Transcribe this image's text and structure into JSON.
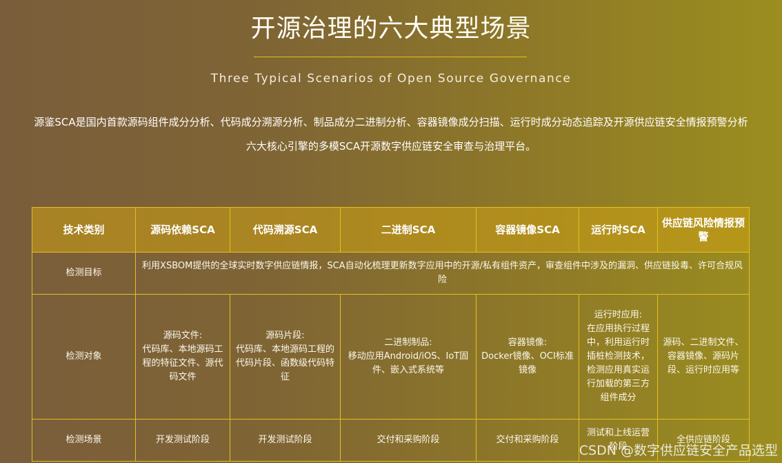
{
  "header": {
    "title": "开源治理的六大典型场景",
    "subtitle": "Three Typical Scenarios of Open Source Governance",
    "description": "源鉴SCA是国内首款源码组件成分分析、代码成分溯源分析、制品成分二进制分析、容器镜像成分扫描、运行时成分动态追踪及开源供应链安全情报预警分析六大核心引擎的多模SCA开源数字供应链安全审查与治理平台。"
  },
  "table": {
    "headers": [
      "技术类别",
      "源码依赖SCA",
      "代码溯源SCA",
      "二进制SCA",
      "容器镜像SCA",
      "运行时SCA",
      "供应链风险情报预警"
    ],
    "rows": {
      "target": {
        "label": "检测目标",
        "text": "利用XSBOM提供的全球实时数字供应链情报，SCA自动化梳理更新数字应用中的开源/私有组件资产，审查组件中涉及的漏洞、供应链投毒、许可合规风险"
      },
      "object": {
        "label": "检测对象",
        "cells": [
          "源码文件:\n代码库、本地源码工程的特征文件、源代码文件",
          "源码片段:\n代码库、本地源码工程的代码片段、函数级代码特征",
          "二进制制品:\n移动应用Android/iOS、IoT固件、嵌入式系统等",
          "容器镜像:\nDocker镜像、OCI标准镜像",
          "运行时应用:\n在应用执行过程中，利用运行时插桩检测技术，检测应用真实运行加载的第三方组件成分",
          "源码、二进制文件、容器镜像、源码片段、运行时应用等"
        ]
      },
      "scene": {
        "label": "检测场景",
        "cells": [
          "开发测试阶段",
          "开发测试阶段",
          "交付和采购阶段",
          "交付和采购阶段",
          "测试和上线运营阶段",
          "全供应链阶段"
        ]
      }
    }
  },
  "watermark": "CSDN @数字供应链安全产品选型"
}
